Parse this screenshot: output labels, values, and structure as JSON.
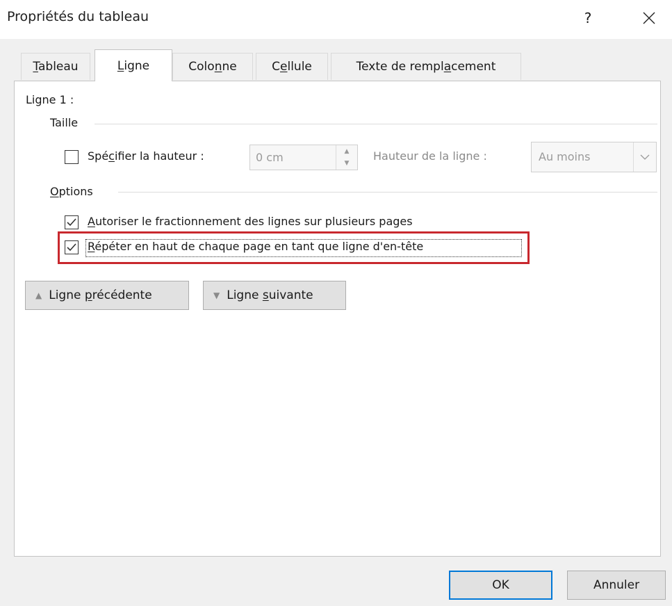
{
  "window": {
    "title": "Propriétés du tableau",
    "help_label": "?"
  },
  "tabs": [
    {
      "label_parts": [
        "",
        "T",
        "ableau"
      ]
    },
    {
      "label_parts": [
        "",
        "L",
        "igne"
      ],
      "active": true
    },
    {
      "label_parts": [
        "Colo",
        "n",
        "ne"
      ]
    },
    {
      "label_parts": [
        "C",
        "e",
        "llule"
      ]
    },
    {
      "label_parts": [
        "Texte de rempl",
        "a",
        "cement"
      ]
    }
  ],
  "panel": {
    "row_label": "Ligne 1 :",
    "size_group": "Taille",
    "specify_height": {
      "parts": [
        "Spé",
        "c",
        "ifier la hauteur :"
      ],
      "checked": false
    },
    "height_value": "0 cm",
    "row_height_label": "Hauteur de la ligne :",
    "row_height_select": "Au moins",
    "options_group_parts": [
      "",
      "O",
      "ptions"
    ],
    "allow_break": {
      "parts": [
        "",
        "A",
        "utoriser le fractionnement des lignes sur plusieurs pages"
      ],
      "checked": true
    },
    "repeat_header": {
      "parts": [
        "",
        "R",
        "épéter en haut de chaque page en tant que ligne d'en-tête"
      ],
      "checked": true
    },
    "prev_row": {
      "parts": [
        "Ligne ",
        "p",
        "récédente"
      ]
    },
    "next_row": {
      "parts": [
        "Ligne ",
        "s",
        "uivante"
      ]
    }
  },
  "buttons": {
    "ok": "OK",
    "cancel": "Annuler"
  },
  "colors": {
    "highlight": "#c8282e",
    "default_button_border": "#0078d7"
  }
}
